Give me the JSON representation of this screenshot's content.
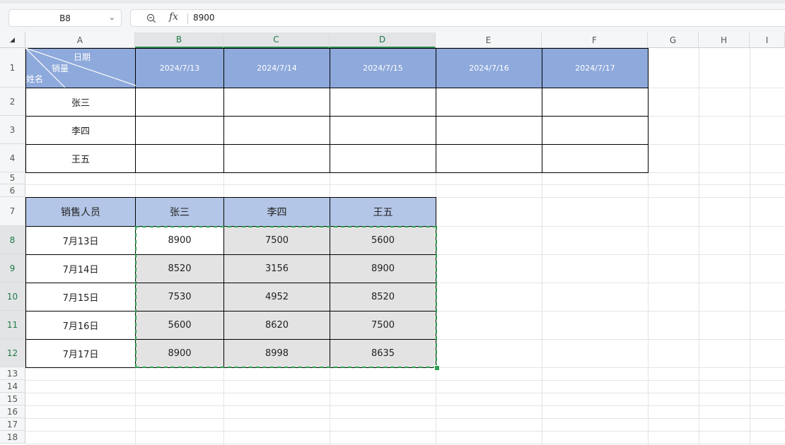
{
  "formula_bar": {
    "name_box": "B8",
    "formula_value": "8900"
  },
  "columns": [
    "A",
    "B",
    "C",
    "D",
    "E",
    "F",
    "G",
    "H",
    "I"
  ],
  "rows": [
    "1",
    "2",
    "3",
    "4",
    "5",
    "6",
    "7",
    "8",
    "9",
    "10",
    "11",
    "12",
    "13",
    "14",
    "15",
    "16",
    "17",
    "18"
  ],
  "table1": {
    "corner_labels": {
      "date": "日期",
      "sales": "销量",
      "name": "姓名"
    },
    "dates": [
      "2024/7/13",
      "2024/7/14",
      "2024/7/15",
      "2024/7/16",
      "2024/7/17"
    ],
    "names": [
      "张三",
      "李四",
      "王五"
    ]
  },
  "table2": {
    "header": [
      "销售人员",
      "张三",
      "李四",
      "王五"
    ],
    "rows": [
      {
        "date": "7月13日",
        "values": [
          "8900",
          "7500",
          "5600"
        ]
      },
      {
        "date": "7月14日",
        "values": [
          "8520",
          "3156",
          "8900"
        ]
      },
      {
        "date": "7月15日",
        "values": [
          "7530",
          "4952",
          "8520"
        ]
      },
      {
        "date": "7月16日",
        "values": [
          "5600",
          "8620",
          "7500"
        ]
      },
      {
        "date": "7月17日",
        "values": [
          "8900",
          "8998",
          "8635"
        ]
      }
    ]
  },
  "colors": {
    "header1_fill": "#8ea9db",
    "header7_fill": "#b4c6e7",
    "selection_border": "#2e9b4f",
    "selection_fill": "#e3e3e3"
  },
  "icons": [
    "zoom-out-icon",
    "function-icon",
    "dropdown-chevron-icon",
    "select-all-triangle-icon"
  ]
}
